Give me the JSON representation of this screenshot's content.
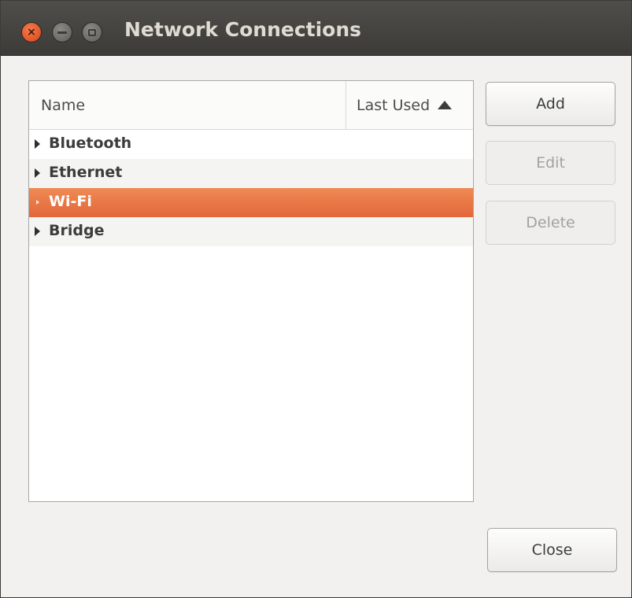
{
  "window": {
    "title": "Network Connections",
    "controls": {
      "close": "×"
    }
  },
  "list": {
    "columns": [
      {
        "label": "Name"
      },
      {
        "label": "Last Used",
        "sort": "ascending"
      }
    ],
    "rows": [
      {
        "label": "Bluetooth",
        "selected": false
      },
      {
        "label": "Ethernet",
        "selected": false
      },
      {
        "label": "Wi-Fi",
        "selected": true
      },
      {
        "label": "Bridge",
        "selected": false
      }
    ]
  },
  "buttons": {
    "add": "Add",
    "edit": "Edit",
    "delete": "Delete",
    "close": "Close"
  },
  "colors": {
    "selection": "#e9703f",
    "titlebar": "#3c3b37",
    "close_button": "#e5531f"
  }
}
